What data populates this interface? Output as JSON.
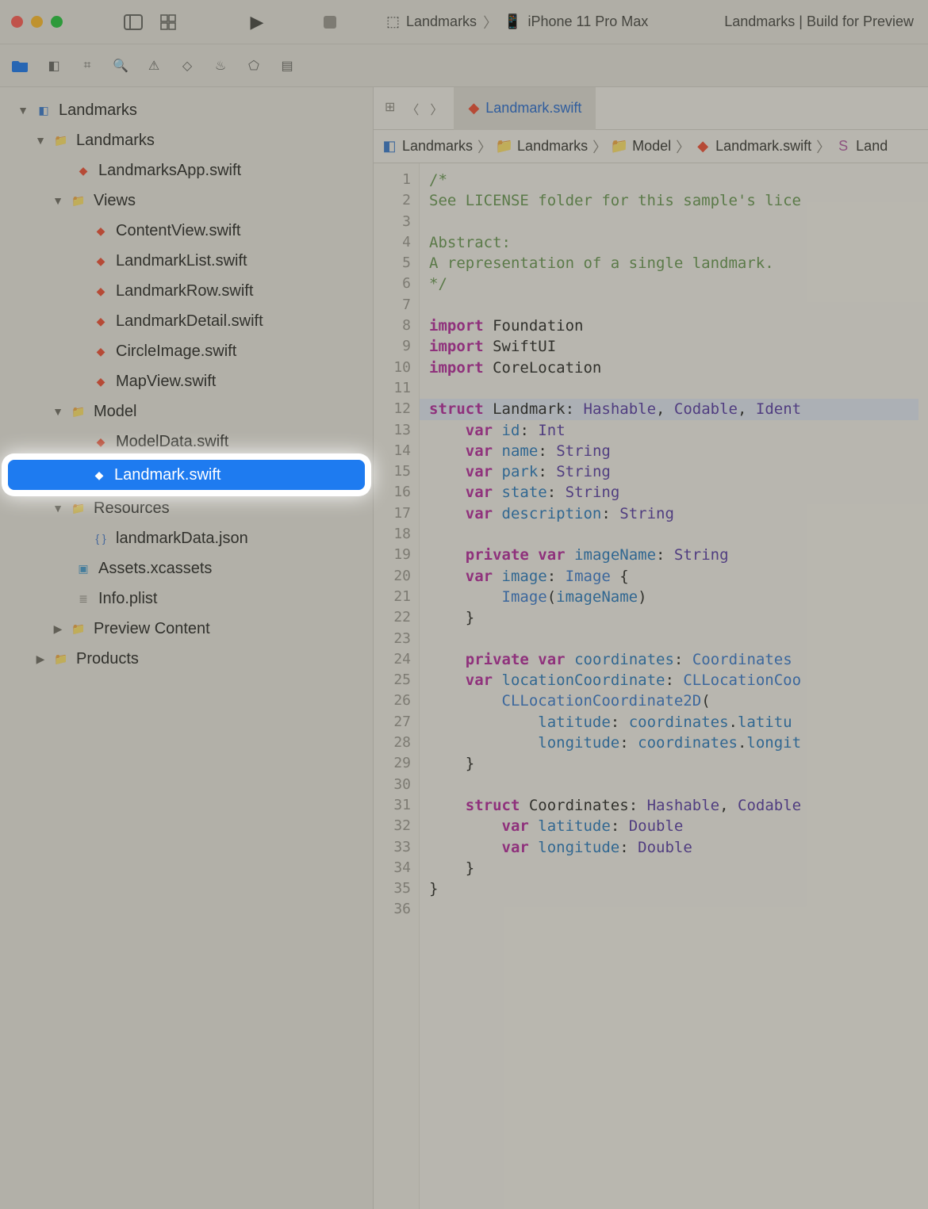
{
  "titlebar": {
    "scheme_project": "Landmarks",
    "scheme_device": "iPhone 11 Pro Max",
    "activity": "Landmarks | Build for Preview"
  },
  "tabbar": {
    "active_tab": "Landmark.swift"
  },
  "breadcrumb": {
    "items": [
      "Landmarks",
      "Landmarks",
      "Model",
      "Landmark.swift",
      "Land"
    ]
  },
  "tree": {
    "root": "Landmarks",
    "group": "Landmarks",
    "app_file": "LandmarksApp.swift",
    "views_group": "Views",
    "views_files": [
      "ContentView.swift",
      "LandmarkList.swift",
      "LandmarkRow.swift",
      "LandmarkDetail.swift",
      "CircleImage.swift",
      "MapView.swift"
    ],
    "model_group": "Model",
    "model_files": [
      "ModelData.swift"
    ],
    "selected_file": "Landmark.swift",
    "resources_group": "Resources",
    "resources_files": [
      "landmarkData.json"
    ],
    "assets": "Assets.xcassets",
    "plist": "Info.plist",
    "preview": "Preview Content",
    "products": "Products"
  },
  "code": {
    "lines": [
      {
        "n": 1,
        "html": "<span class='tok-comment'>/*</span>"
      },
      {
        "n": 2,
        "html": "<span class='tok-comment'>See LICENSE folder for this sample's lice</span>"
      },
      {
        "n": 3,
        "html": ""
      },
      {
        "n": 4,
        "html": "<span class='tok-comment'>Abstract:</span>"
      },
      {
        "n": 5,
        "html": "<span class='tok-comment'>A representation of a single landmark.</span>"
      },
      {
        "n": 6,
        "html": "<span class='tok-comment'>*/</span>"
      },
      {
        "n": 7,
        "html": ""
      },
      {
        "n": 8,
        "html": "<span class='tok-keyword'>import</span> <span class='tok-plain'>Foundation</span>"
      },
      {
        "n": 9,
        "html": "<span class='tok-keyword'>import</span> <span class='tok-plain'>SwiftUI</span>"
      },
      {
        "n": 10,
        "html": "<span class='tok-keyword'>import</span> <span class='tok-plain'>CoreLocation</span>"
      },
      {
        "n": 11,
        "html": ""
      },
      {
        "n": 12,
        "hl": true,
        "html": "<span class='tok-keyword'>struct</span> <span class='tok-plain'>Landmark</span>: <span class='tok-type'>Hashable</span>, <span class='tok-type'>Codable</span>, <span class='tok-type'>Ident</span>"
      },
      {
        "n": 13,
        "html": "    <span class='tok-keyword'>var</span> <span class='tok-prop'>id</span>: <span class='tok-type'>Int</span>"
      },
      {
        "n": 14,
        "html": "    <span class='tok-keyword'>var</span> <span class='tok-prop'>name</span>: <span class='tok-type'>String</span>"
      },
      {
        "n": 15,
        "html": "    <span class='tok-keyword'>var</span> <span class='tok-prop'>park</span>: <span class='tok-type'>String</span>"
      },
      {
        "n": 16,
        "html": "    <span class='tok-keyword'>var</span> <span class='tok-prop'>state</span>: <span class='tok-type'>String</span>"
      },
      {
        "n": 17,
        "html": "    <span class='tok-keyword'>var</span> <span class='tok-prop'>description</span>: <span class='tok-type'>String</span>"
      },
      {
        "n": 18,
        "html": ""
      },
      {
        "n": 19,
        "html": "    <span class='tok-keyword'>private</span> <span class='tok-keyword'>var</span> <span class='tok-prop'>imageName</span>: <span class='tok-type'>String</span>"
      },
      {
        "n": 20,
        "html": "    <span class='tok-keyword'>var</span> <span class='tok-prop'>image</span>: <span class='tok-typestd'>Image</span> {"
      },
      {
        "n": 21,
        "html": "        <span class='tok-typestd'>Image</span>(<span class='tok-ident'>imageName</span>)"
      },
      {
        "n": 22,
        "html": "    }"
      },
      {
        "n": 23,
        "html": ""
      },
      {
        "n": 24,
        "html": "    <span class='tok-keyword'>private</span> <span class='tok-keyword'>var</span> <span class='tok-prop'>coordinates</span>: <span class='tok-typestd'>Coordinates</span>"
      },
      {
        "n": 25,
        "html": "    <span class='tok-keyword'>var</span> <span class='tok-prop'>locationCoordinate</span>: <span class='tok-typestd'>CLLocationCoo</span>"
      },
      {
        "n": 26,
        "html": "        <span class='tok-typestd'>CLLocationCoordinate2D</span>("
      },
      {
        "n": 27,
        "html": "            <span class='tok-ident'>latitude</span>: <span class='tok-ident'>coordinates</span>.<span class='tok-ident'>latitu</span>"
      },
      {
        "n": 28,
        "html": "            <span class='tok-ident'>longitude</span>: <span class='tok-ident'>coordinates</span>.<span class='tok-ident'>longit</span>"
      },
      {
        "n": 29,
        "html": "    }"
      },
      {
        "n": 30,
        "html": ""
      },
      {
        "n": 31,
        "html": "    <span class='tok-keyword'>struct</span> <span class='tok-plain'>Coordinates</span>: <span class='tok-type'>Hashable</span>, <span class='tok-type'>Codable</span>"
      },
      {
        "n": 32,
        "html": "        <span class='tok-keyword'>var</span> <span class='tok-prop'>latitude</span>: <span class='tok-type'>Double</span>"
      },
      {
        "n": 33,
        "html": "        <span class='tok-keyword'>var</span> <span class='tok-prop'>longitude</span>: <span class='tok-type'>Double</span>"
      },
      {
        "n": 34,
        "html": "    }"
      },
      {
        "n": 35,
        "html": "}"
      },
      {
        "n": 36,
        "html": ""
      }
    ]
  }
}
